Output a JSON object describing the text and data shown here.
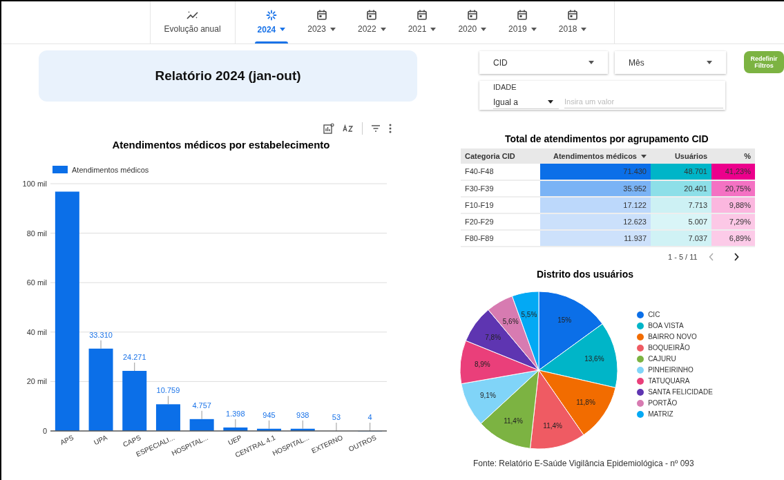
{
  "tabs": [
    {
      "kind": "trend",
      "label": "Evolução anual",
      "selected": false
    },
    {
      "kind": "year",
      "label": "2024",
      "selected": true
    },
    {
      "kind": "year",
      "label": "2023",
      "selected": false
    },
    {
      "kind": "year",
      "label": "2022",
      "selected": false
    },
    {
      "kind": "year",
      "label": "2021",
      "selected": false
    },
    {
      "kind": "year",
      "label": "2020",
      "selected": false
    },
    {
      "kind": "year",
      "label": "2019",
      "selected": false
    },
    {
      "kind": "year",
      "label": "2018",
      "selected": false
    }
  ],
  "report_title": "Relatório 2024 (jan-out)",
  "bar_chart": {
    "chart_data": {
      "type": "bar",
      "title": "Atendimentos médicos por estabelecimento",
      "categories": [
        "APS",
        "UPA",
        "CAPS",
        "ESPECIALI...",
        "HOSPITAL...",
        "UEP",
        "CENTRAL 4.1",
        "HOSPITAL...",
        "EXTERNO",
        "OUTROS"
      ],
      "series": [
        {
          "name": "Atendimentos médicos",
          "color": "#0b6fe8",
          "values": [
            96.8,
            33.3,
            24.3,
            10.8,
            4.8,
            1.4,
            0.9,
            0.9,
            null,
            0
          ]
        }
      ],
      "ylim": [
        0,
        100
      ],
      "grid": true,
      "yticks": [
        {
          "value": 0,
          "label": "0"
        },
        {
          "value": 20,
          "label": "20 mil"
        },
        {
          "value": 40,
          "label": "40 mil"
        },
        {
          "value": 60,
          "label": "60 mil"
        },
        {
          "value": 80,
          "label": "80 mil"
        },
        {
          "value": 100,
          "label": "100 mil"
        }
      ],
      "value_labels": [
        null,
        "33.310",
        "24.271",
        "10.759",
        "4.757",
        "1.398",
        "945",
        "938",
        "53",
        "4"
      ]
    }
  },
  "filters": {
    "cid": {
      "label": "CID"
    },
    "month": {
      "label": "Mês"
    },
    "reset": "Redefinir Filtros",
    "age": {
      "label": "IDADE",
      "operator": "Igual a",
      "placeholder": "Insira um valor"
    }
  },
  "table": {
    "title": "Total de atendimentos por agrupamento CID",
    "columns": [
      {
        "label": "Categoria CID",
        "sorted": false
      },
      {
        "label": "Atendimentos médicos",
        "sorted": true
      },
      {
        "label": "Usuários",
        "sorted": false
      },
      {
        "label": "%",
        "sorted": false
      }
    ],
    "rows": [
      [
        {
          "text": "F40-F48",
          "color": "#ffffff"
        },
        {
          "text": "71.430",
          "color": "#0b6fe8"
        },
        {
          "text": "48.701",
          "color": "#00b5c8"
        },
        {
          "text": "41,23%",
          "color": "#ec008c"
        }
      ],
      [
        {
          "text": "F30-F39",
          "color": "#ffffff"
        },
        {
          "text": "35.952",
          "color": "#7ab3f5"
        },
        {
          "text": "20.401",
          "color": "#8ddfe8"
        },
        {
          "text": "20,75%",
          "color": "#f472c3"
        }
      ],
      [
        {
          "text": "F10-F19",
          "color": "#ffffff"
        },
        {
          "text": "17.122",
          "color": "#bcd8fb"
        },
        {
          "text": "7.713",
          "color": "#cdf1f4"
        },
        {
          "text": "9,88%",
          "color": "#fbb7df"
        }
      ],
      [
        {
          "text": "F20-F29",
          "color": "#ffffff"
        },
        {
          "text": "12.623",
          "color": "#cbe0fb"
        },
        {
          "text": "5.007",
          "color": "#d9f5f7"
        },
        {
          "text": "7,29%",
          "color": "#fcc8e6"
        }
      ],
      [
        {
          "text": "F80-F89",
          "color": "#ffffff"
        },
        {
          "text": "11.937",
          "color": "#cde1fb"
        },
        {
          "text": "7.037",
          "color": "#d0f2f5"
        },
        {
          "text": "6,89%",
          "color": "#fccbe8"
        }
      ]
    ],
    "pagination": "1 - 5 / 11"
  },
  "pie_chart": {
    "chart_data": {
      "type": "pie",
      "title": "Distrito dos usuários",
      "categories": [
        "CIC",
        "BOA VISTA",
        "BAIRRO NOVO",
        "BOQUEIRÃO",
        "CAJURU",
        "PINHEIRINHO",
        "TATUQUARA",
        "SANTA FELICIDADE",
        "PORTÃO",
        "MATRIZ"
      ],
      "values": [
        15,
        13.6,
        11.8,
        11.4,
        11.4,
        9.1,
        8.9,
        7.8,
        5.6,
        5.5
      ],
      "legend": "right",
      "colors": [
        "#0b6fe8",
        "#00b5c8",
        "#f26c00",
        "#ef5b63",
        "#7cb342",
        "#80d4f8",
        "#ea3f7a",
        "#5e35b1",
        "#d77bb1",
        "#03a9f4"
      ],
      "value_labels": [
        "15%",
        "13,6%",
        "11,8%",
        "11,4%",
        "11,4%",
        "9,1%",
        "8,9%",
        "7,8%",
        "5,6%",
        "5,5%"
      ]
    }
  },
  "source": "Fonte: Relatório E-Saúde Vigilância Epidemiológica - nº 093"
}
